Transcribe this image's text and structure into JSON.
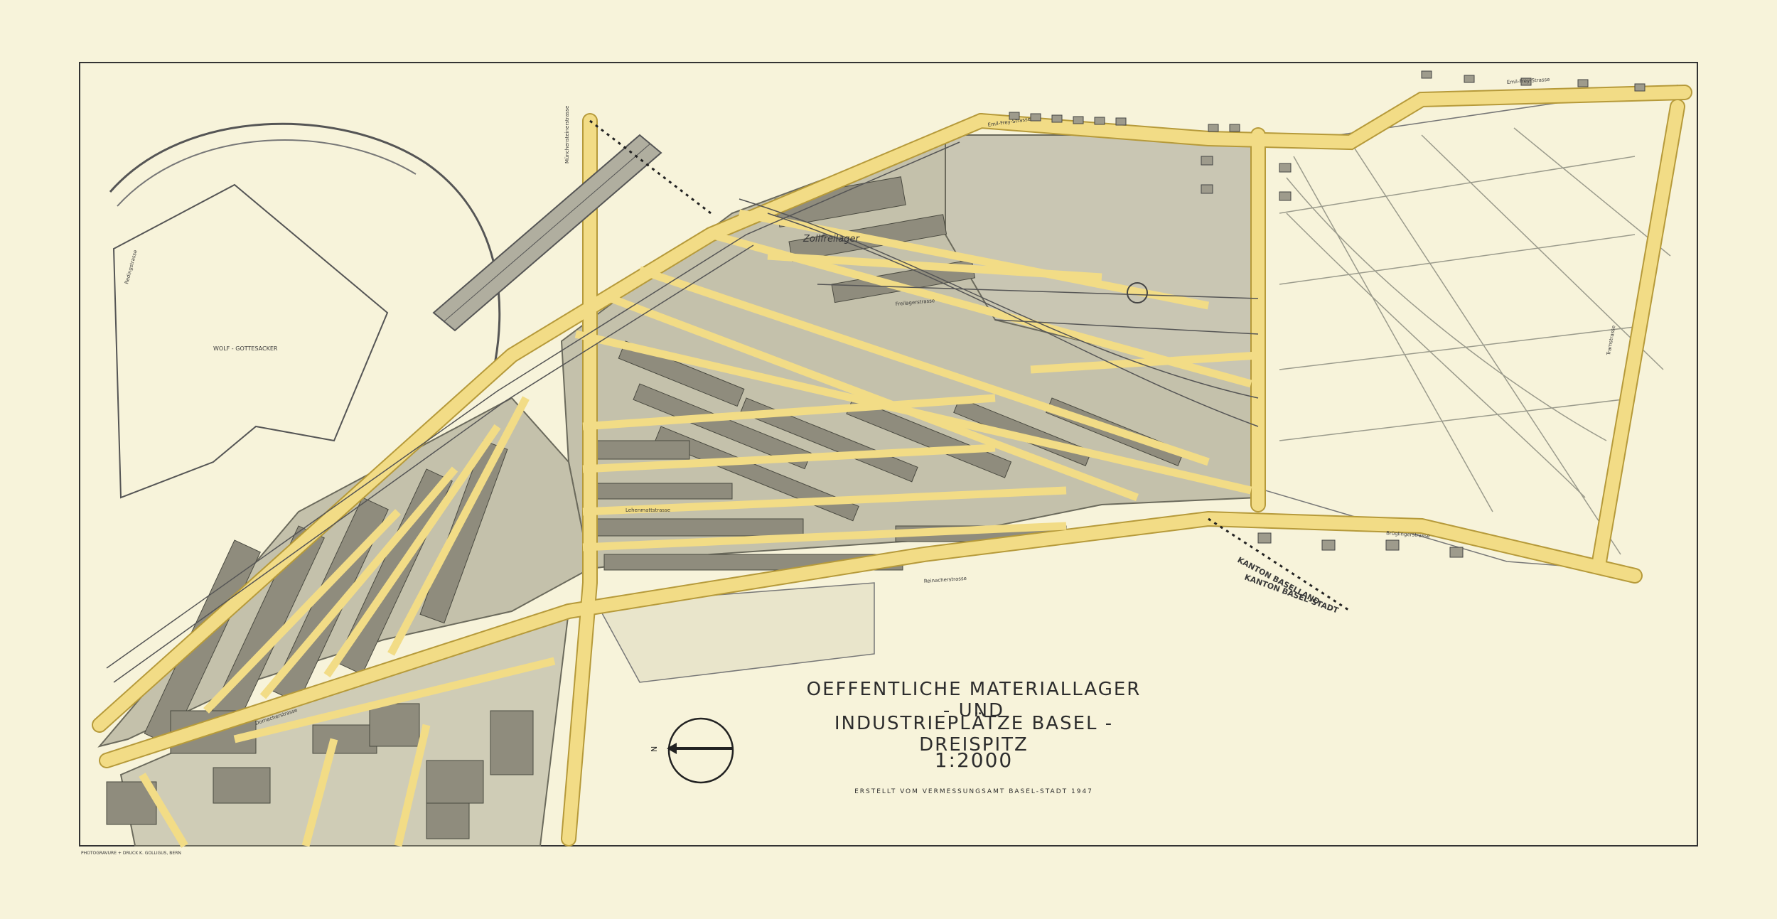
{
  "title": {
    "line1": "OEFFENTLICHE MATERIALLAGER - UND",
    "line2": "INDUSTRIEPLÄTZE BASEL - DREISPITZ",
    "scale": "1:2000",
    "credit": "ERSTELLT VOM VERMESSUNGSAMT BASEL-STADT 1947"
  },
  "printer_note": "PHOTOGRAVURE + DRUCK K. GOLLIGUS, BERN",
  "compass": {
    "letter": "N",
    "icon": "north-arrow-icon"
  },
  "labels": {
    "wolf_gottesacker": "WOLF - GOTTESACKER",
    "zollfreilager": "Zollfreilager",
    "emil_frey_strasse": "Emil-Frey-Strasse",
    "kanton_baselland": "KANTON BASELLAND",
    "kanton_basel_stadt": "KANTON BASEL-STADT",
    "muenchensteinerstrasse": "Münchensteinerstrasse",
    "freilagerstrasse": "Freilagerstrasse",
    "lehenmattstrasse": "Lehenmattstrasse",
    "reinacherstrasse": "Reinacherstrasse",
    "dornacherstrasse": "Dornacherstrasse",
    "brueglingerstrasse": "Brüglingerstrasse",
    "tramstrasse": "Tramstrasse",
    "redingstrasse": "Redingstrasse"
  },
  "colors": {
    "paper": "#f7f3da",
    "street": "#f2dc86",
    "street_edge": "#b69a3a",
    "parcel": "#c4c1ab",
    "building": "#8f8c7d",
    "ink": "#2d2d2d"
  }
}
